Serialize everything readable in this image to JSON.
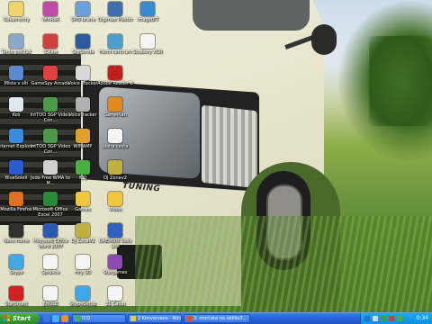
{
  "desktop": {
    "wallpaper": {
      "badge_text": "TUNING",
      "badge_subtext": ""
    },
    "icons": [
      {
        "id": "dokumenty",
        "label": "Dokumenty",
        "icon": "my-documents-icon",
        "color": "#f1d36b"
      },
      {
        "id": "winrar",
        "label": "WinRaR",
        "icon": "winrar-icon",
        "color": "#c04aa8"
      },
      {
        "id": "sms-brana",
        "label": "SMS brana",
        "icon": "sms-gateway-icon",
        "color": "#6aa0d8"
      },
      {
        "id": "digimax-master",
        "label": "Digimax Master",
        "icon": "digimax-icon",
        "color": "#3b6fb0"
      },
      {
        "id": "imagebit",
        "label": "ImageBIT",
        "icon": "imagebit-icon",
        "color": "#3a8ad0"
      },
      {
        "id": "tento-pocitac",
        "label": "Tento počítač",
        "icon": "my-computer-icon",
        "color": "#8aa9c8"
      },
      {
        "id": "icraw",
        "label": "ICRaw",
        "icon": "icraw-icon",
        "color": "#d04040"
      },
      {
        "id": "skysenda",
        "label": "SkySenda",
        "icon": "skysenda-icon",
        "color": "#2a5aa0"
      },
      {
        "id": "herni-centrum",
        "label": "Herní centrum",
        "icon": "game-center-icon",
        "color": "#4aa0c8"
      },
      {
        "id": "mista-v-siti",
        "label": "Místa v síti",
        "icon": "network-places-icon",
        "color": "#5a8ad0"
      },
      {
        "id": "gamespy-arcade",
        "label": "GameSpy Arcade",
        "icon": "gamespy-icon",
        "color": "#e04040"
      },
      {
        "id": "voice-tracker",
        "label": "Voice Tracker",
        "icon": "voice-tracker-icon",
        "color": "#d8d8d8"
      },
      {
        "id": "adobe-reader",
        "label": "Adobe Reader 8",
        "icon": "adobe-reader-icon",
        "color": "#c02020"
      },
      {
        "id": "kos",
        "label": "Koš",
        "icon": "recycle-bin-icon",
        "color": "#dfe7ef"
      },
      {
        "id": "intoo-3gp-1",
        "label": "IntTOO 3GP Video Con...",
        "icon": "intoo-3gp-icon",
        "color": "#4a9a4a"
      },
      {
        "id": "voicetracker",
        "label": "VoiceTracker",
        "icon": "voicetracker-icon",
        "color": "#b0b0b0"
      },
      {
        "id": "gameplan",
        "label": "GamePlan",
        "icon": "gameplan-icon",
        "color": "#e08a20"
      },
      {
        "id": "internet-explorer",
        "label": "Internet Explorer",
        "icon": "internet-explorer-icon",
        "color": "#3a8ae0"
      },
      {
        "id": "intoo-3gp-2",
        "label": "IntTOO 3GP Video Con...",
        "icon": "intoo-3gp-icon",
        "color": "#4a9a4a"
      },
      {
        "id": "winamp",
        "label": "WINAMP",
        "icon": "winamp-icon",
        "color": "#e0a030"
      },
      {
        "id": "uloha-cesta",
        "label": "úloha cesta",
        "icon": "text-document-icon",
        "color": "#f4f4f4"
      },
      {
        "id": "bluesoleil",
        "label": "BlueSoleil",
        "icon": "bluesoleil-icon",
        "color": "#2a5ad0"
      },
      {
        "id": "joda-free-wma",
        "label": "Joda Free WMA to M...",
        "icon": "joda-icon",
        "color": "#d0d0d0"
      },
      {
        "id": "icq",
        "label": "ICQ",
        "icon": "icq-flower-icon",
        "color": "#4ab040"
      },
      {
        "id": "dj-zonav2",
        "label": "DJ Zonav2",
        "icon": "dj-zona-icon",
        "color": "#c0b040"
      },
      {
        "id": "mozilla-firefox",
        "label": "Mozilla Firefox",
        "icon": "firefox-icon",
        "color": "#e07020"
      },
      {
        "id": "ms-office-excel",
        "label": "Microsoft Office Excel 2007",
        "icon": "excel-icon",
        "color": "#2a8a3a"
      },
      {
        "id": "games",
        "label": "Games",
        "icon": "folder-icon",
        "color": "#f0c840"
      },
      {
        "id": "video",
        "label": "Video",
        "icon": "folder-icon",
        "color": "#f0c840"
      },
      {
        "id": "nero-home",
        "label": "Nero Home",
        "icon": "nero-icon",
        "color": "#303030"
      },
      {
        "id": "ms-office-word",
        "label": "Microsoft Office Word 2007",
        "icon": "word-icon",
        "color": "#2a5ab0"
      },
      {
        "id": "dj-zonav2-2",
        "label": "DJ ZonaV2",
        "icon": "dj-zona-icon",
        "color": "#c0b040"
      },
      {
        "id": "daemon-tools",
        "label": "DAEMON Tools Lite",
        "icon": "daemon-tools-icon",
        "color": "#3060c0"
      },
      {
        "id": "skype",
        "label": "Skype",
        "icon": "skype-icon",
        "color": "#40a8e8"
      },
      {
        "id": "spravce",
        "label": "Správce",
        "icon": "text-document-icon",
        "color": "#f4f4f4"
      },
      {
        "id": "hry-3d",
        "label": "Hry 3D",
        "icon": "text-document-icon",
        "color": "#f4f4f4"
      },
      {
        "id": "stargames",
        "label": "Stargames",
        "icon": "game-icon",
        "color": "#8a4ab0"
      },
      {
        "id": "starsmart",
        "label": "StarSmart",
        "icon": "starsmart-icon",
        "color": "#d02020"
      },
      {
        "id": "jingle",
        "label": "JINGLE",
        "icon": "text-document-icon",
        "color": "#f4f4f4"
      },
      {
        "id": "skypesetup",
        "label": "SkypeSetup",
        "icon": "skypesetup-icon",
        "color": "#40a8e8"
      },
      {
        "id": "21-cdlot",
        "label": "21 Čaluo",
        "icon": "text-document-icon",
        "color": "#f4f4f4"
      },
      {
        "id": "soubory-xgr",
        "label": "Soubory XGR",
        "icon": "text-document-icon",
        "color": "#f4f4f4"
      }
    ]
  },
  "taskbar": {
    "start_label": "Start",
    "quicklaunch": [
      {
        "icon": "show-desktop-icon",
        "color": "#3a7ad8"
      },
      {
        "icon": "internet-explorer-icon",
        "color": "#4ab0f0"
      },
      {
        "icon": "media-player-icon",
        "color": "#e89020"
      }
    ],
    "tasks": [
      {
        "label": "ICQ",
        "icon": "icq-flower-icon",
        "color": "#4ab040"
      },
      {
        "label": "2 Konverzace - Nicol - ...",
        "icon": "chat-window-icon",
        "color": "#e8c840"
      },
      {
        "label": "3. morčata na obliku3...",
        "icon": "browser-window-icon",
        "color": "#e05030"
      }
    ],
    "tray_icons": [
      {
        "icon": "bluetooth-icon",
        "color": "#2a6ad8"
      },
      {
        "icon": "volume-icon",
        "color": "#d8d8d8"
      },
      {
        "icon": "network-icon",
        "color": "#40a040"
      },
      {
        "icon": "security-icon",
        "color": "#d04040"
      },
      {
        "icon": "icq-tray-icon",
        "color": "#4ab040"
      }
    ],
    "clock": "0:34"
  }
}
